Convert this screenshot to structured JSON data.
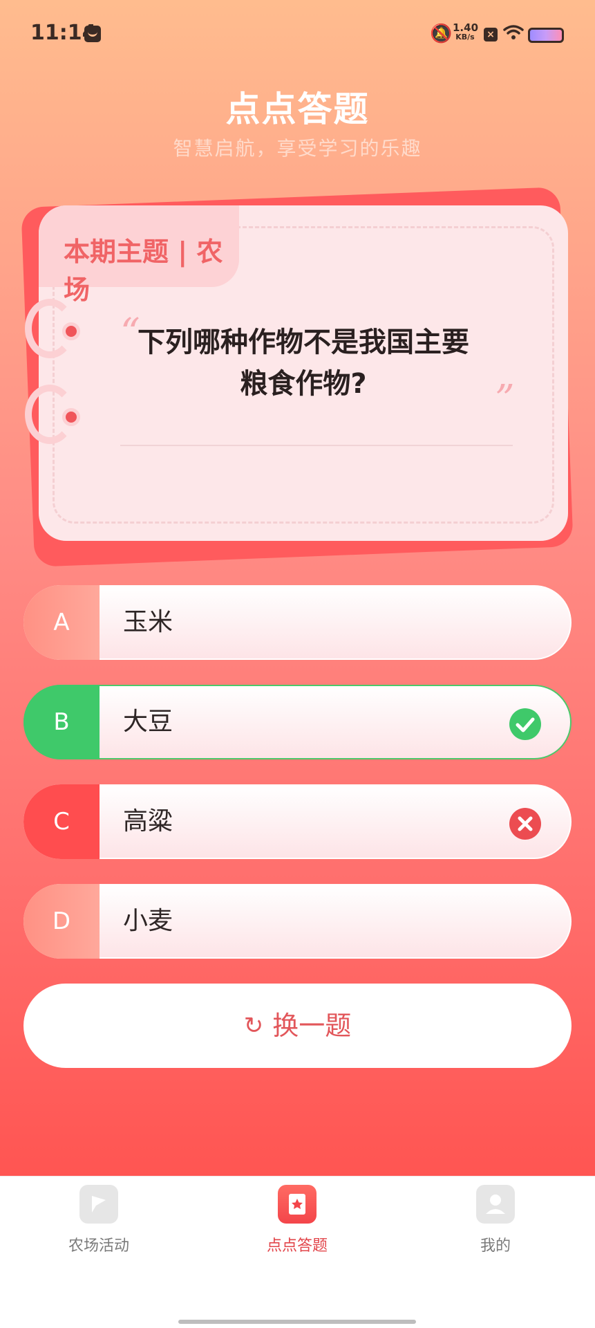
{
  "status_bar": {
    "time": "11:14",
    "net_speed_value": "1.40",
    "net_speed_unit": "KB/s"
  },
  "header": {
    "title": "点点答题",
    "subtitle": "智慧启航，享受学习的乐趣"
  },
  "card": {
    "topic": "本期主题 | 农场",
    "quote_open": "“",
    "quote_close": "”",
    "question_line1": "下列哪种作物不是我国主要",
    "question_line2": "粮食作物?"
  },
  "options": [
    {
      "letter": "A",
      "text": "玉米",
      "state": "neutral"
    },
    {
      "letter": "B",
      "text": "大豆",
      "state": "correct"
    },
    {
      "letter": "C",
      "text": "高粱",
      "state": "wrong"
    },
    {
      "letter": "D",
      "text": "小麦",
      "state": "neutral"
    }
  ],
  "change_button": {
    "icon": "refresh-icon",
    "label": "换一题"
  },
  "bottom_nav": [
    {
      "label": "农场活动",
      "icon": "flag-icon",
      "active": false
    },
    {
      "label": "点点答题",
      "icon": "star-icon",
      "active": true
    },
    {
      "label": "我的",
      "icon": "profile-icon",
      "active": false
    }
  ],
  "colors": {
    "accent": "#e2565a",
    "correct": "#3fc96a",
    "wrong": "#ff4d4f"
  }
}
